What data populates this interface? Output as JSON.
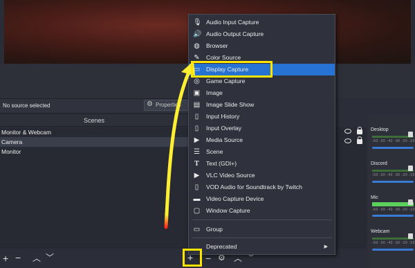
{
  "source_strip": {
    "status": "No source selected",
    "properties_label": "Properties"
  },
  "scenes": {
    "header": "Scenes",
    "items": [
      {
        "label": "Monitor & Webcam"
      },
      {
        "label": "Camera"
      },
      {
        "label": "Monitor"
      }
    ]
  },
  "toolbar_icons": {
    "add": "plus-icon",
    "remove": "minus-icon",
    "up": "chevron-up-icon",
    "down": "chevron-down-icon",
    "settings": "gear-icon"
  },
  "mixer": {
    "tracks": [
      {
        "label": "Desktop",
        "scale": "-60 -50 -40 -30 -20 -10 0"
      },
      {
        "label": "Discord",
        "scale": "-60 -50 -40 -30 -20 -10 0"
      },
      {
        "label": "Mic",
        "scale": "-60 -50 -40 -30 -20 -10 0"
      },
      {
        "label": "Webcam",
        "scale": "-60 -50 -40 -30 -20 -10 0"
      }
    ]
  },
  "context_menu": {
    "items": [
      {
        "label": "Audio Input Capture",
        "icon": "microphone-icon"
      },
      {
        "label": "Audio Output Capture",
        "icon": "speaker-icon"
      },
      {
        "label": "Browser",
        "icon": "globe-icon"
      },
      {
        "label": "Color Source",
        "icon": "paintbrush-icon"
      },
      {
        "label": "Display Capture",
        "icon": "monitor-icon"
      },
      {
        "label": "Game Capture",
        "icon": "gamepad-icon"
      },
      {
        "label": "Image",
        "icon": "image-icon"
      },
      {
        "label": "Image Slide Show",
        "icon": "slideshow-icon"
      },
      {
        "label": "Input History",
        "icon": "text-cursor-icon"
      },
      {
        "label": "Input Overlay",
        "icon": "text-cursor-icon"
      },
      {
        "label": "Media Source",
        "icon": "play-icon"
      },
      {
        "label": "Scene",
        "icon": "list-icon"
      },
      {
        "label": "Text (GDI+)",
        "icon": "text-icon"
      },
      {
        "label": "VLC Video Source",
        "icon": "play-icon"
      },
      {
        "label": "VOD Audio for Soundtrack by Twitch",
        "icon": "text-cursor-icon"
      },
      {
        "label": "Video Capture Device",
        "icon": "camera-icon"
      },
      {
        "label": "Window Capture",
        "icon": "window-icon"
      },
      {
        "label": "Group",
        "icon": "folder-icon"
      },
      {
        "label": "Deprecated",
        "icon": "",
        "submenu": true
      }
    ],
    "highlighted": "Display Capture"
  },
  "colors": {
    "highlight_box": "#ffe400",
    "menu_highlight": "#2773d3",
    "arrow": "#ffee33"
  }
}
